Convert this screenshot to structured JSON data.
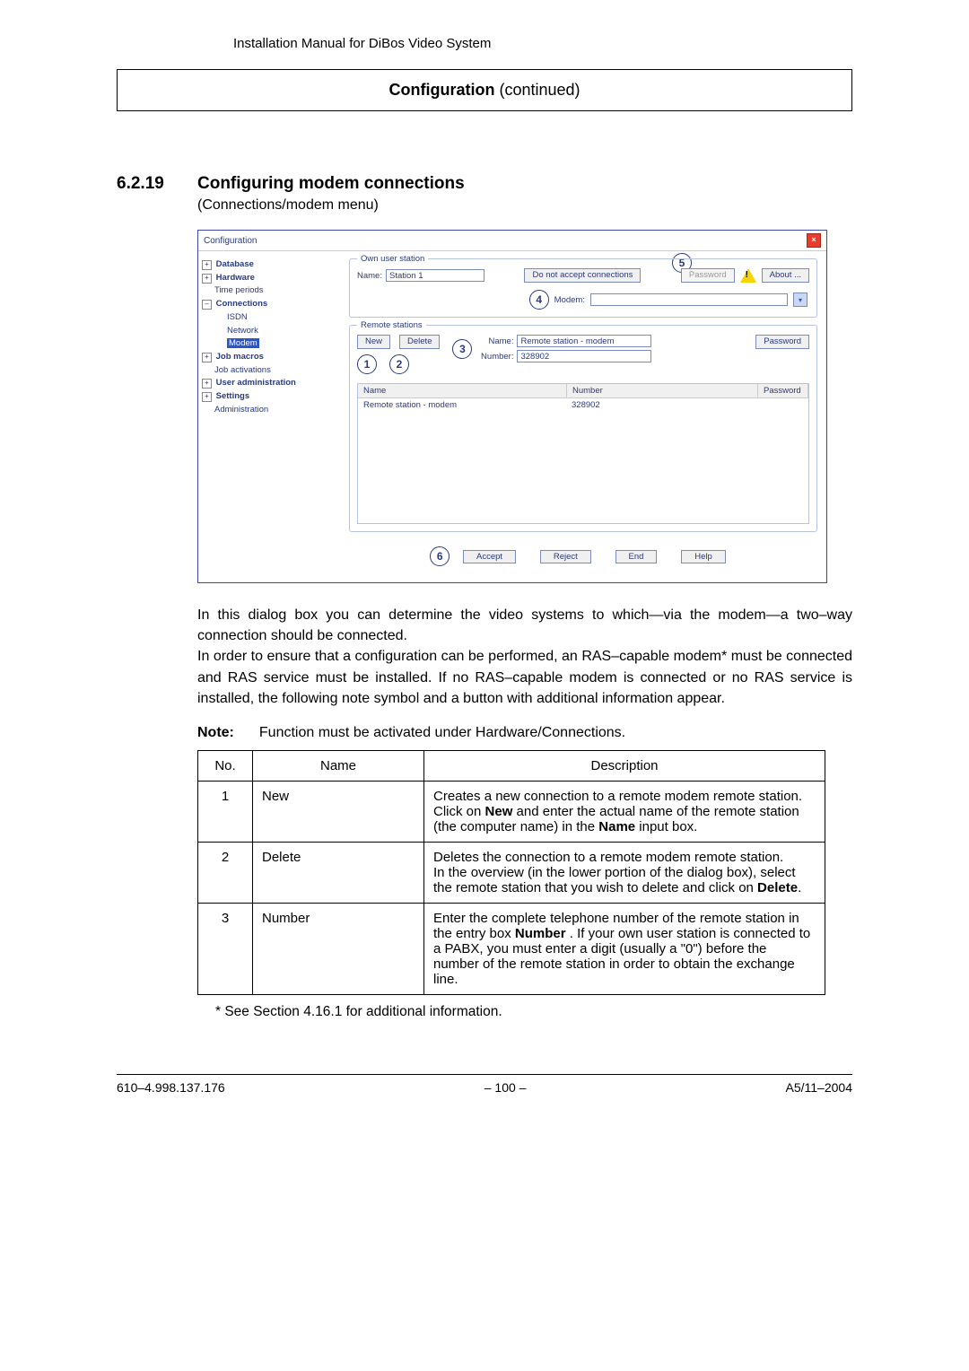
{
  "doc": {
    "header": "Installation Manual for DiBos Video System",
    "config_banner_b": "Configuration",
    "config_banner_rest": " (continued)",
    "section_num": "6.2.19",
    "section_title": "Configuring modem connections",
    "subtitle": "(Connections/modem menu)"
  },
  "screenshot": {
    "title": "Configuration",
    "close": "×",
    "tree": {
      "database": "Database",
      "hardware": "Hardware",
      "time_periods": "Time periods",
      "connections": "Connections",
      "isdn": "ISDN",
      "network": "Network",
      "modem": "Modem",
      "job_macros": "Job macros",
      "job_activations": "Job activations",
      "user_admin": "User administration",
      "settings": "Settings",
      "administration": "Administration"
    },
    "own_legend": "Own user station",
    "name_lbl": "Name:",
    "name_val": "Station 1",
    "dnac": "Do not accept connections",
    "password_btn": "Password",
    "about_btn": "About ...",
    "modem_lbl": "Modem:",
    "remote_legend": "Remote stations",
    "new_btn": "New",
    "delete_btn": "Delete",
    "rname_lbl": "Name:",
    "rname_val": "Remote station - modem",
    "number_lbl": "Number:",
    "number_val": "328902",
    "pw_btn": "Password",
    "cols": {
      "name": "Name",
      "number": "Number",
      "password": "Password"
    },
    "row": {
      "name": "Remote station - modem",
      "number": "328902"
    },
    "accept": "Accept",
    "reject": "Reject",
    "end": "End",
    "help": "Help",
    "callouts": {
      "c1": "1",
      "c2": "2",
      "c3": "3",
      "c4": "4",
      "c5": "5",
      "c6": "6"
    }
  },
  "body": {
    "p1": "In this dialog box you can determine the video systems to which—via the modem—a two–way connection should be connected.",
    "p2": "In order to ensure that a configuration can be performed, an RAS–capable modem* must be connected and RAS service must be installed. If no RAS–capable modem is connected or no RAS service is installed, the following note symbol and a button with additional information appear.",
    "note_b": "Note:",
    "note_t": "Function must be activated under Hardware/Connections."
  },
  "table": {
    "h_no": "No.",
    "h_name": "Name",
    "h_desc": "Description",
    "r1": {
      "no": "1",
      "name": "New",
      "d1": "Creates a new connection to a remote modem remote station.",
      "d2a": "Click on ",
      "d2b": "New",
      "d2c": " and enter the actual name of the remote station (the computer name) in the ",
      "d2d": "Name",
      "d2e": " input box."
    },
    "r2": {
      "no": "2",
      "name": "Delete",
      "d1": "Deletes the connection to a remote modem remote station.",
      "d2a": "In the overview (in the lower portion of the dialog box), select the remote station that you wish to delete and click on ",
      "d2b": "Delete",
      "d2c": "."
    },
    "r3": {
      "no": "3",
      "name": "Number",
      "d1a": "Enter the complete telephone number of the remote station in the entry box ",
      "d1b": "Number",
      "d1c": " . If your own user station is connected to a PABX, you must enter a digit (usually a \"0\") before the number of the remote station in order to obtain the exchange line."
    }
  },
  "footnote": "* See Section 4.16.1 for additional information.",
  "footer": {
    "left": "610–4.998.137.176",
    "mid": "–  100  –",
    "right": "A5/11–2004"
  }
}
